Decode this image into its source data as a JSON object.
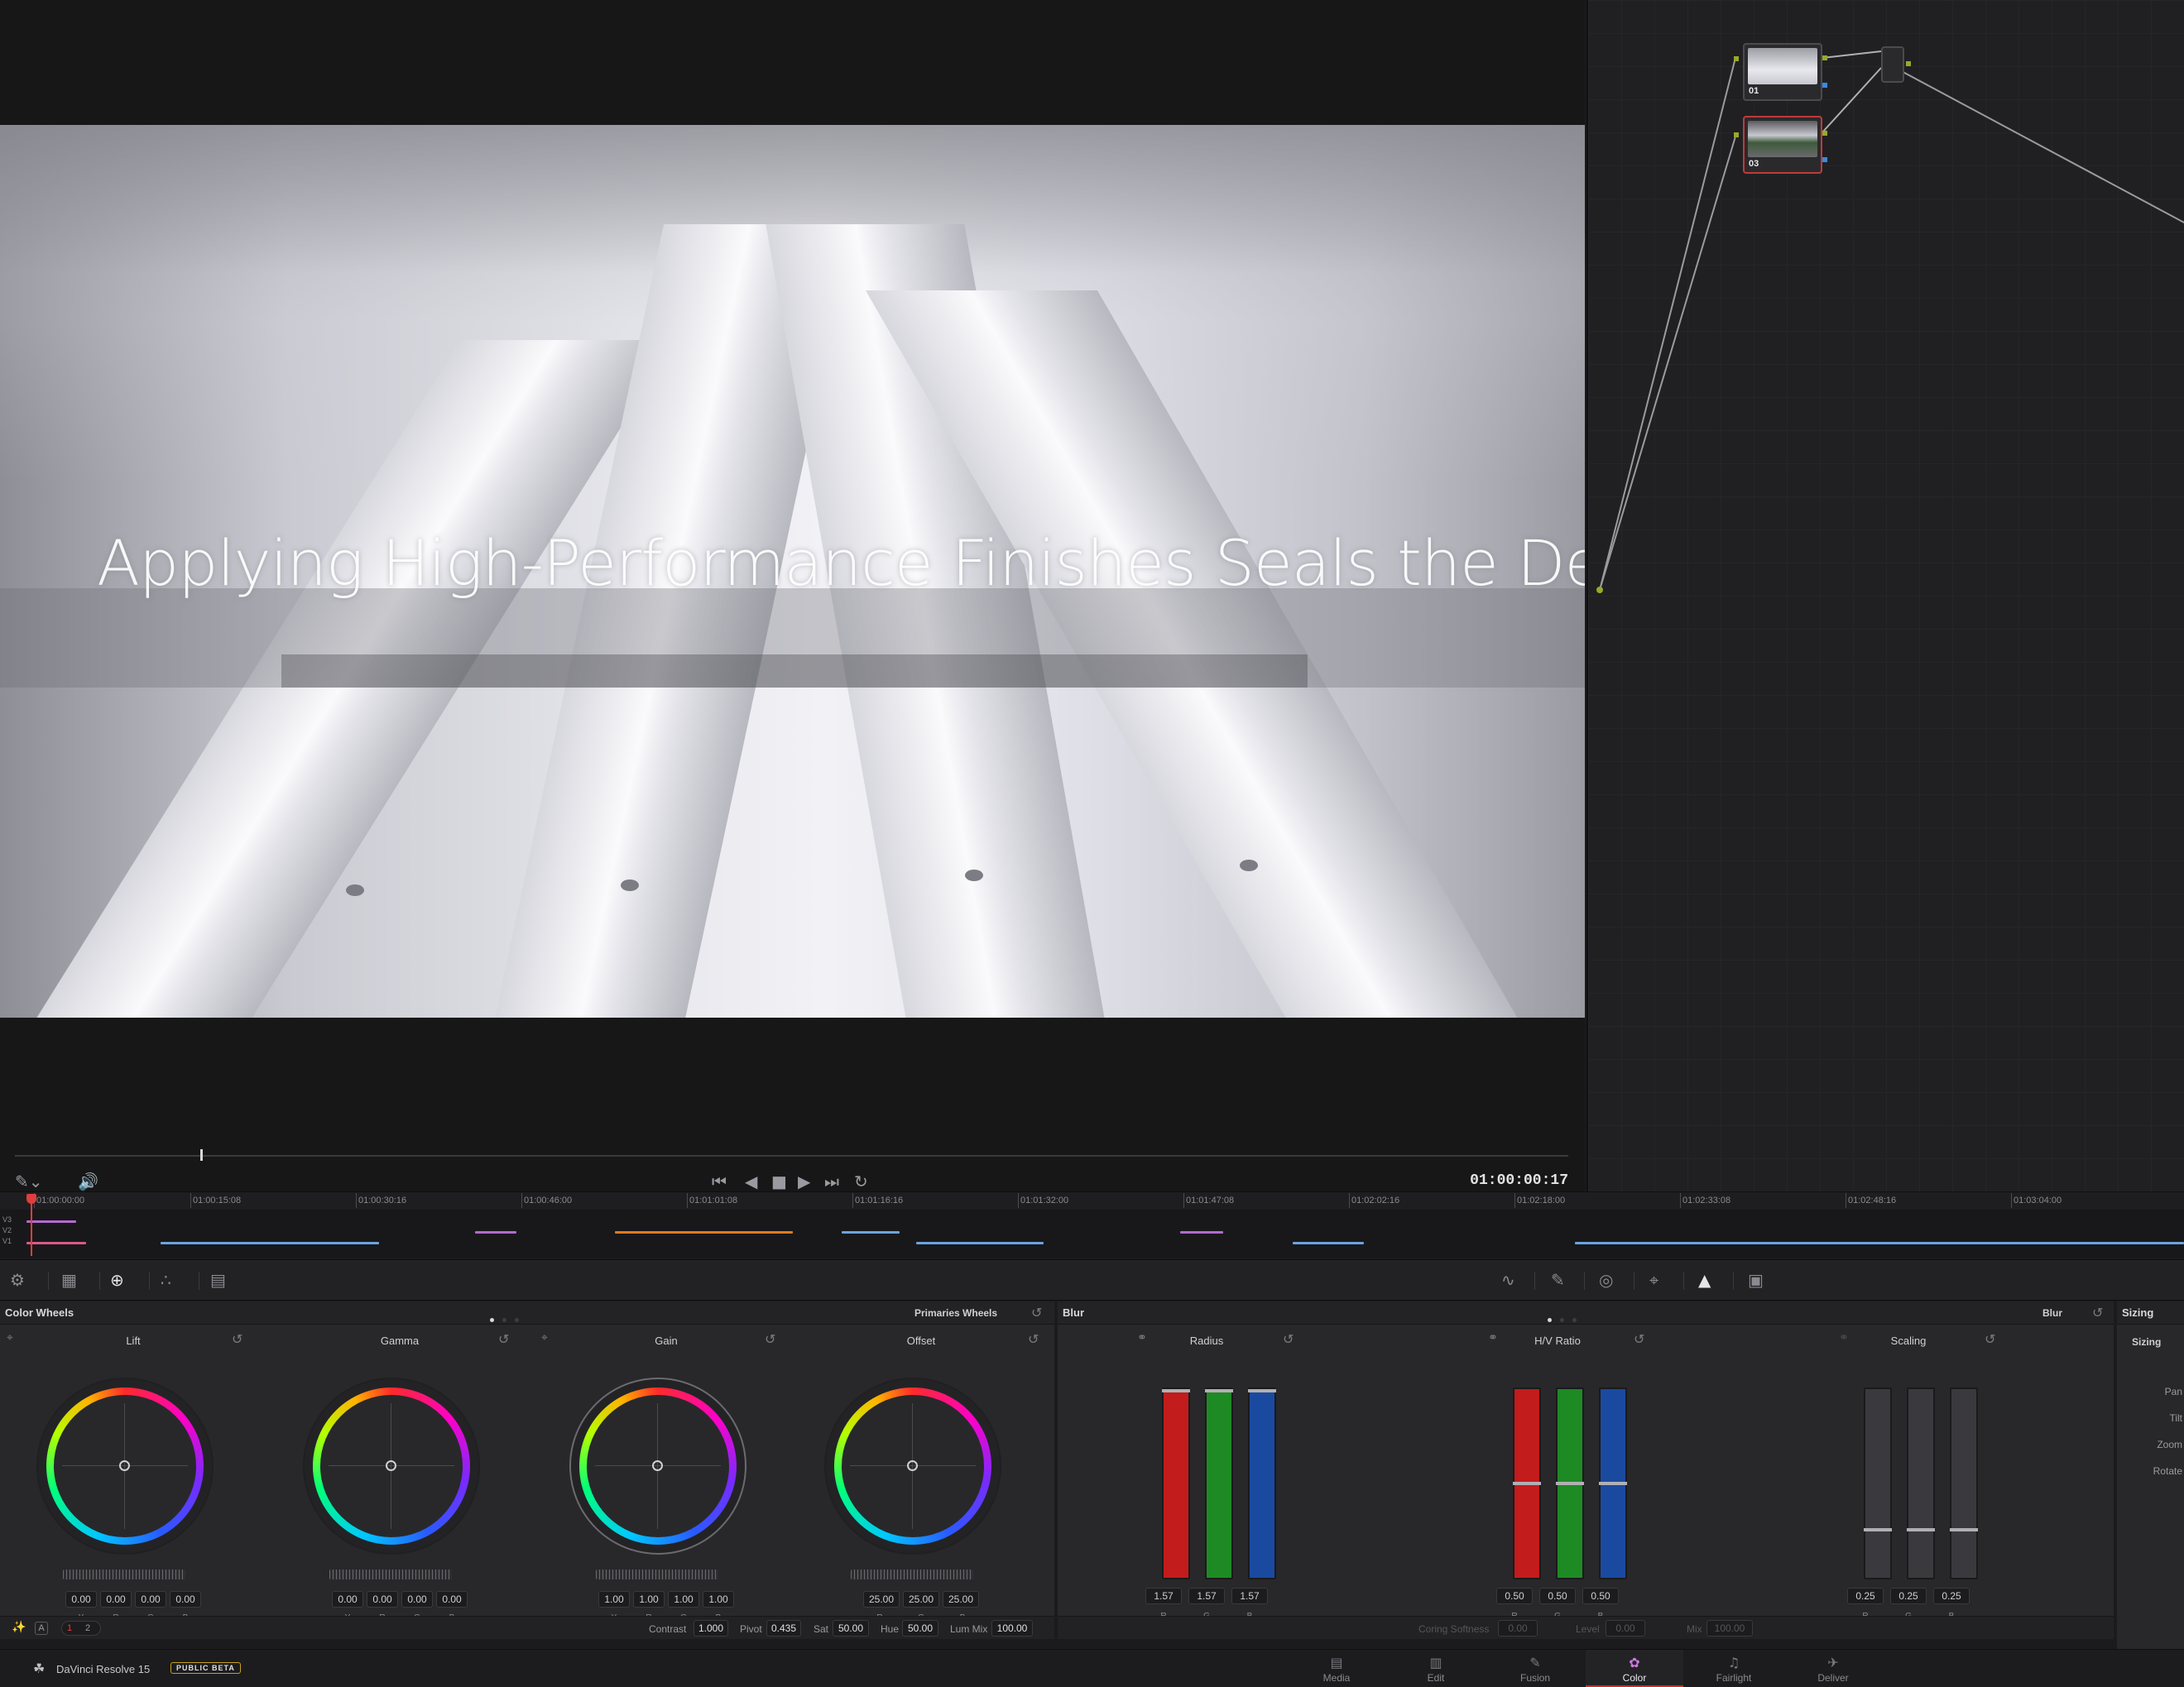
{
  "viewer": {
    "title_overlay": "Applying High-Performance Finishes Seals the Deal",
    "timecode": "01:00:00:17",
    "scrub_progress": 0.13
  },
  "nodes": [
    {
      "label": "01",
      "active": false
    },
    {
      "label": "03",
      "active": true
    }
  ],
  "timeline": {
    "ticks": [
      "01:00:00:00",
      "01:00:15:08",
      "01:00:30:16",
      "01:00:46:00",
      "01:01:01:08",
      "01:01:16:16",
      "01:01:32:00",
      "01:01:47:08",
      "01:02:02:16",
      "01:02:18:00",
      "01:02:33:08",
      "01:02:48:16",
      "01:03:04:00"
    ],
    "tracks": [
      "V3",
      "V2",
      "V1"
    ]
  },
  "color_wheels": {
    "title": "Color Wheels",
    "mode": "Primaries Wheels",
    "wheels": [
      {
        "name": "Lift",
        "values": [
          "0.00",
          "0.00",
          "0.00",
          "0.00"
        ],
        "channels": [
          "Y",
          "R",
          "G",
          "B"
        ]
      },
      {
        "name": "Gamma",
        "values": [
          "0.00",
          "0.00",
          "0.00",
          "0.00"
        ],
        "channels": [
          "Y",
          "R",
          "G",
          "B"
        ]
      },
      {
        "name": "Gain",
        "values": [
          "1.00",
          "1.00",
          "1.00",
          "1.00"
        ],
        "channels": [
          "Y",
          "R",
          "G",
          "B"
        ]
      },
      {
        "name": "Offset",
        "values": [
          "25.00",
          "25.00",
          "25.00"
        ],
        "channels": [
          "R",
          "G",
          "B"
        ]
      }
    ],
    "pages": [
      "1",
      "2"
    ],
    "params": {
      "contrast_label": "Contrast",
      "contrast": "1.000",
      "pivot_label": "Pivot",
      "pivot": "0.435",
      "sat_label": "Sat",
      "sat": "50.00",
      "hue_label": "Hue",
      "hue": "50.00",
      "lummix_label": "Lum Mix",
      "lummix": "100.00"
    }
  },
  "blur": {
    "title": "Blur",
    "mode": "Blur",
    "groups": [
      {
        "name": "Radius",
        "values": [
          "1.57",
          "1.57",
          "1.57"
        ],
        "channels": [
          "R",
          "G",
          "B"
        ],
        "level": 1.0
      },
      {
        "name": "H/V Ratio",
        "values": [
          "0.50",
          "0.50",
          "0.50"
        ],
        "channels": [
          "R",
          "G",
          "B"
        ],
        "level": 0.5
      },
      {
        "name": "Scaling",
        "values": [
          "0.25",
          "0.25",
          "0.25"
        ],
        "channels": [
          "R",
          "G",
          "B"
        ],
        "level": 0.25
      }
    ],
    "params": {
      "coring_label": "Coring Softness",
      "coring": "0.00",
      "level_label": "Level",
      "level": "0.00",
      "mix_label": "Mix",
      "mix": "100.00"
    }
  },
  "sizing": {
    "title": "Sizing",
    "subtitle": "Sizing",
    "rows": [
      "Pan",
      "Tilt",
      "Zoom",
      "Rotate"
    ]
  },
  "status": {
    "app_name": "DaVinci Resolve 15",
    "badge": "PUBLIC BETA"
  },
  "pages": [
    {
      "label": "Media",
      "icon": "media-icon"
    },
    {
      "label": "Edit",
      "icon": "edit-icon"
    },
    {
      "label": "Fusion",
      "icon": "fusion-icon"
    },
    {
      "label": "Color",
      "icon": "color-icon"
    },
    {
      "label": "Fairlight",
      "icon": "fairlight-icon"
    },
    {
      "label": "Deliver",
      "icon": "deliver-icon"
    }
  ],
  "colors": {
    "accent_red": "#c4302b",
    "node_link": "#9aa82a"
  }
}
